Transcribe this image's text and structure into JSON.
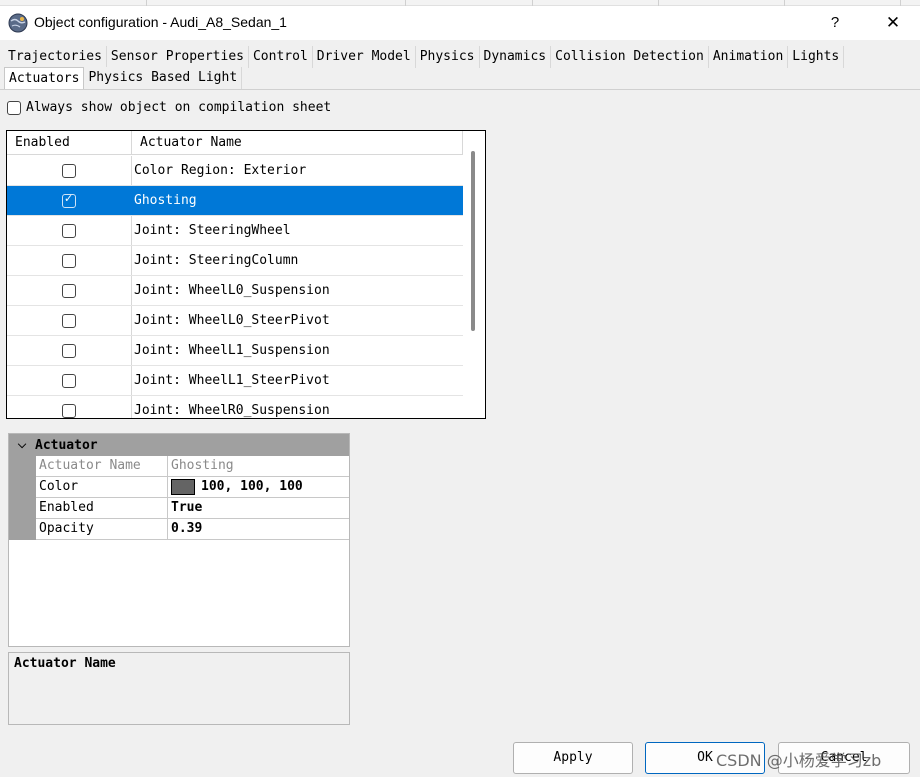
{
  "window": {
    "title": "Object configuration - Audi_A8_Sedan_1",
    "help_label": "?",
    "close_label": "✕"
  },
  "tabs_row1": [
    "Trajectories",
    "Sensor Properties",
    "Control",
    "Driver Model",
    "Physics",
    "Dynamics",
    "Collision Detection",
    "Animation",
    "Lights"
  ],
  "tabs_row2": [
    "Actuators",
    "Physics Based Light"
  ],
  "always_show": {
    "label": "Always show object on compilation sheet",
    "checked": false
  },
  "grid": {
    "headers": {
      "enabled": "Enabled",
      "name": "Actuator Name"
    },
    "rows": [
      {
        "enabled": false,
        "name": "Color Region: Exterior",
        "selected": false
      },
      {
        "enabled": true,
        "name": "Ghosting",
        "selected": true
      },
      {
        "enabled": false,
        "name": "Joint: SteeringWheel",
        "selected": false
      },
      {
        "enabled": false,
        "name": "Joint: SteeringColumn",
        "selected": false
      },
      {
        "enabled": false,
        "name": "Joint: WheelL0_Suspension",
        "selected": false
      },
      {
        "enabled": false,
        "name": "Joint: WheelL0_SteerPivot",
        "selected": false
      },
      {
        "enabled": false,
        "name": "Joint: WheelL1_Suspension",
        "selected": false
      },
      {
        "enabled": false,
        "name": "Joint: WheelL1_SteerPivot",
        "selected": false
      },
      {
        "enabled": false,
        "name": "Joint: WheelR0_Suspension",
        "selected": false
      }
    ]
  },
  "properties": {
    "section": "Actuator",
    "actuator_name_label": "Actuator Name",
    "actuator_name_value": "Ghosting",
    "color_label": "Color",
    "color_value": "100,  100,  100",
    "color_hex": "#646464",
    "enabled_label": "Enabled",
    "enabled_value": "True",
    "opacity_label": "Opacity",
    "opacity_value": "0.39"
  },
  "description": {
    "title": "Actuator Name"
  },
  "buttons": {
    "apply": "Apply",
    "ok": "OK",
    "cancel": "Cancel"
  },
  "watermark": "CSDN @小杨爱学习zb"
}
